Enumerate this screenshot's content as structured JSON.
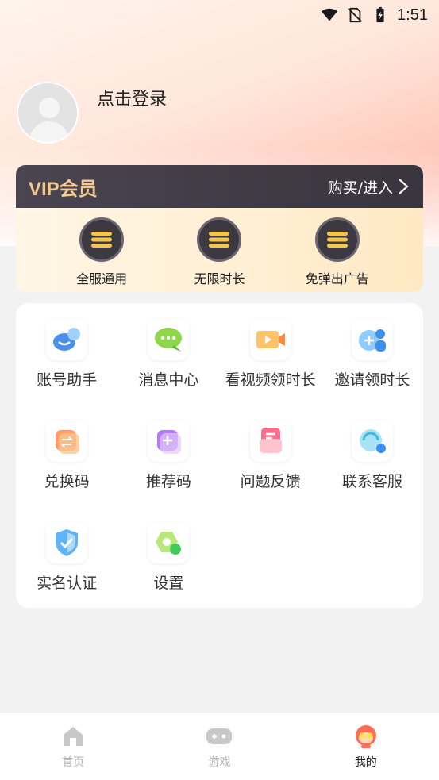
{
  "status_bar": {
    "time": "1:51",
    "icons": [
      "wifi-icon",
      "no-sim-icon",
      "battery-icon"
    ]
  },
  "profile": {
    "login_label": "点击登录"
  },
  "vip": {
    "title": "VIP会员",
    "link_label": "购买/进入",
    "benefits": [
      {
        "label": "全服通用",
        "icon": "coin-stack-icon"
      },
      {
        "label": "无限时长",
        "icon": "coin-stack-icon"
      },
      {
        "label": "免弹出广告",
        "icon": "coin-stack-icon"
      }
    ]
  },
  "menu": {
    "items": [
      {
        "label": "账号助手",
        "icon": "account-helper-icon"
      },
      {
        "label": "消息中心",
        "icon": "message-icon"
      },
      {
        "label": "看视频领时长",
        "icon": "video-icon"
      },
      {
        "label": "邀请领时长",
        "icon": "invite-icon"
      },
      {
        "label": "兑换码",
        "icon": "exchange-icon"
      },
      {
        "label": "推荐码",
        "icon": "recommend-icon"
      },
      {
        "label": "问题反馈",
        "icon": "feedback-icon"
      },
      {
        "label": "联系客服",
        "icon": "customer-service-icon"
      },
      {
        "label": "实名认证",
        "icon": "verify-shield-icon"
      },
      {
        "label": "设置",
        "icon": "settings-icon"
      }
    ]
  },
  "tabs": [
    {
      "label": "首页",
      "icon": "home-icon",
      "active": false
    },
    {
      "label": "游戏",
      "icon": "gamepad-icon",
      "active": false
    },
    {
      "label": "我的",
      "icon": "profile-mascot-icon",
      "active": true
    }
  ],
  "colors": {
    "vip_gold": "#f3c98e",
    "vip_dark": "#3c3a40",
    "accent": "#ff6b57"
  }
}
